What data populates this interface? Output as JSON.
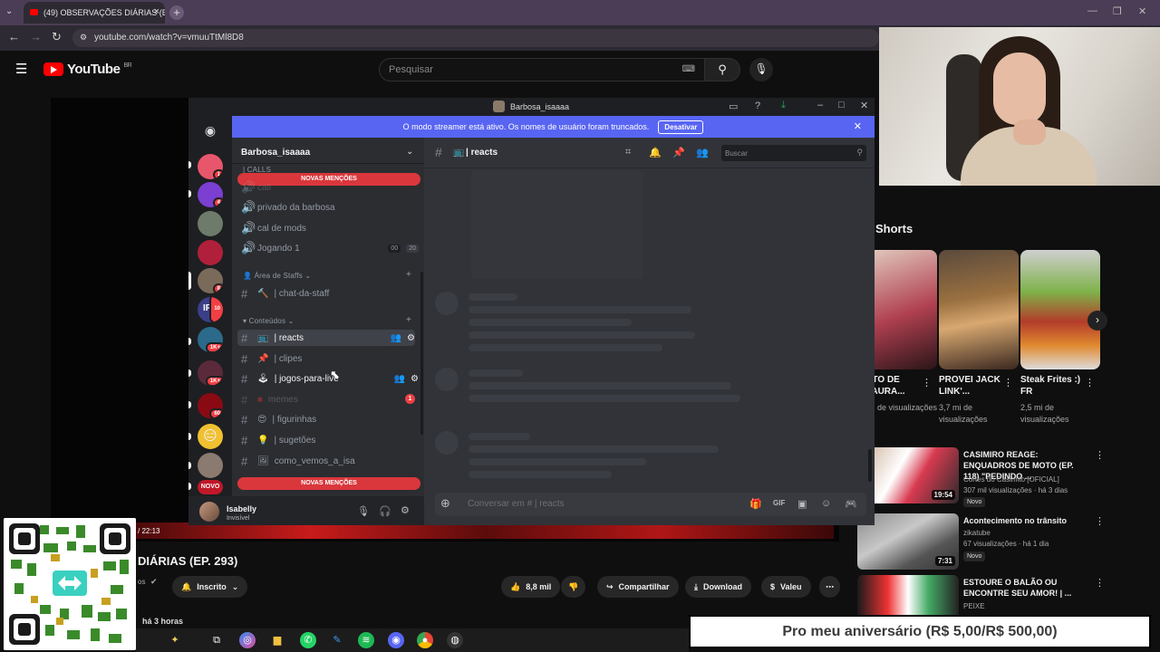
{
  "browser": {
    "tab_title": "(49) OBSERVAÇÕES DIÁRIAS (E",
    "url": "youtube.com/watch?v=vmuuTtMl8D8"
  },
  "youtube": {
    "logo_text": "YouTube",
    "region": "BR",
    "search_placeholder": "Pesquisar",
    "video_title": "DIÁRIAS (EP. 293)",
    "time": "/ 22:13",
    "channel_short": "os",
    "subscribe_label": "Inscrito",
    "likes": "8,8 mil",
    "share_label": "Compartilhar",
    "download_label": "Download",
    "thanks_label": "Valeu",
    "uploaded": "há 3 horas",
    "shorts_header": "Shorts",
    "shorts": [
      {
        "title": "ATO DE TAURA...",
        "views": "mi de visualizações"
      },
      {
        "title": "PROVEI JACK LINK'...",
        "views": "3,7 mi de visualizações"
      },
      {
        "title": "Steak Frites :) FR",
        "views": "2,5 mi de visualizações"
      }
    ],
    "recommendations": [
      {
        "title": "CASIMIRO REAGE: ENQUADROS DE MOTO (EP. 118) \"PEDINDO ...",
        "channel": "Cortes do Casimito [OFICIAL]",
        "meta": "307 mil visualizações · há 3 dias",
        "badge": "Novo",
        "duration": "19:54"
      },
      {
        "title": "Acontecimento no trânsito",
        "channel": "zikatube",
        "meta": "67 visualizações · há 1 dia",
        "badge": "Novo",
        "duration": "7:31"
      },
      {
        "title": "ESTOURE O BALÃO OU ENCONTRE SEU AMOR! | ...",
        "channel": "PEIXE",
        "meta": "",
        "badge": "",
        "duration": ""
      }
    ]
  },
  "discord": {
    "window_title": "Barbosa_isaaaa",
    "streamer_banner": "O modo streamer está ativo. Os nomes de usuário foram truncados.",
    "deactivate_label": "Desativar",
    "server_name": "Barbosa_isaaaa",
    "new_mentions": "NOVAS MENÇÕES",
    "category_calls": "| CALLS",
    "voice_channels": [
      {
        "name": "call"
      },
      {
        "name": "privado da barbosa"
      },
      {
        "name": "cal de mods"
      },
      {
        "name": "Jogando 1",
        "count_a": "00",
        "count_b": "20"
      }
    ],
    "category_staff": "Área de Staffs",
    "staff_channel": "| chat-da-staff",
    "category_content": "Conteúdos",
    "text_channels": [
      {
        "name": "| reacts"
      },
      {
        "name": "| clipes"
      },
      {
        "name": "| jogos-para-live"
      },
      {
        "name": "memes",
        "badge": "1"
      },
      {
        "name": "| figurinhas"
      },
      {
        "name": "| sugetões"
      },
      {
        "name": "como_vemos_a_isa"
      }
    ],
    "current_channel": "| reacts",
    "search_placeholder": "Buscar",
    "composer_placeholder": "Conversar em # | reacts",
    "user_name": "Isabelly",
    "user_status": "Invisível",
    "servers": [
      {
        "badge": "1"
      },
      {
        "badge": "4"
      },
      {
        "badge": ""
      },
      {
        "badge": ""
      },
      {
        "badge": "8"
      },
      {
        "label": "IRL",
        "badge": "10"
      },
      {
        "badge": "1K+"
      },
      {
        "badge": "1K+"
      },
      {
        "badge": "60"
      },
      {
        "badge": ""
      },
      {
        "badge": ""
      }
    ],
    "new_badge": "NOVO"
  },
  "overlay": {
    "donation_text": "Pro meu aniversário (R$ 5,00/R$ 500,00)"
  },
  "colors": {
    "discord_blurple": "#5865f2",
    "mention_red": "#da373c",
    "youtube_red": "#ff0000"
  }
}
